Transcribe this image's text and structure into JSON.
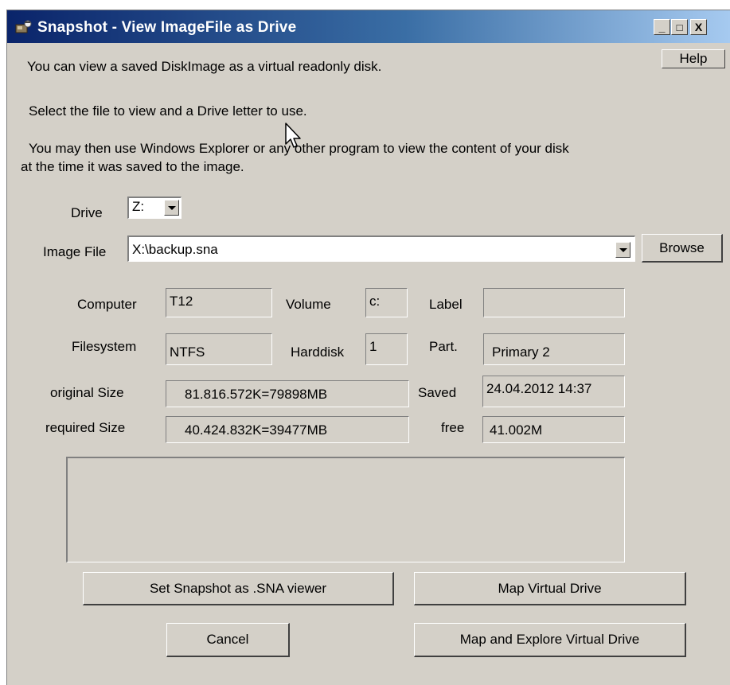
{
  "window": {
    "title": "Snapshot - View ImageFile as Drive",
    "minimize_label": "_",
    "maximize_label": "□",
    "close_label": "X"
  },
  "help_label": "Help",
  "instructions": {
    "line1": "You can view a saved DiskImage as a virtual readonly disk.",
    "line2": "Select the file to view and a Drive letter to use.",
    "line3a": "You may then use Windows Explorer or any other program to view the content of your disk",
    "line3b": "at the time it was saved to the image."
  },
  "drive": {
    "label": "Drive",
    "value": "Z:"
  },
  "image_file": {
    "label": "Image File",
    "value": "X:\\backup.sna",
    "browse_label": "Browse"
  },
  "info": {
    "computer_label": "Computer",
    "computer_value": "T12",
    "volume_label": "Volume",
    "volume_value": "c:",
    "label_label": "Label",
    "label_value": "",
    "filesystem_label": "Filesystem",
    "filesystem_value": "NTFS",
    "harddisk_label": "Harddisk",
    "harddisk_value": "1",
    "part_label": "Part.",
    "part_value": "Primary 2",
    "original_size_label": "original Size",
    "original_size_value": "81.816.572K=79898MB",
    "saved_label": "Saved",
    "saved_value": "24.04.2012 14:37",
    "required_size_label": "required Size",
    "required_size_value": "40.424.832K=39477MB",
    "free_label": "free",
    "free_value": "41.002M"
  },
  "buttons": {
    "set_viewer": "Set Snapshot as .SNA viewer",
    "map_drive": "Map Virtual Drive",
    "cancel": "Cancel",
    "map_explore": "Map and Explore Virtual Drive"
  },
  "colors": {
    "titlebar_start": "#0a246a",
    "titlebar_end": "#a6caf0",
    "face": "#d4d0c8"
  }
}
